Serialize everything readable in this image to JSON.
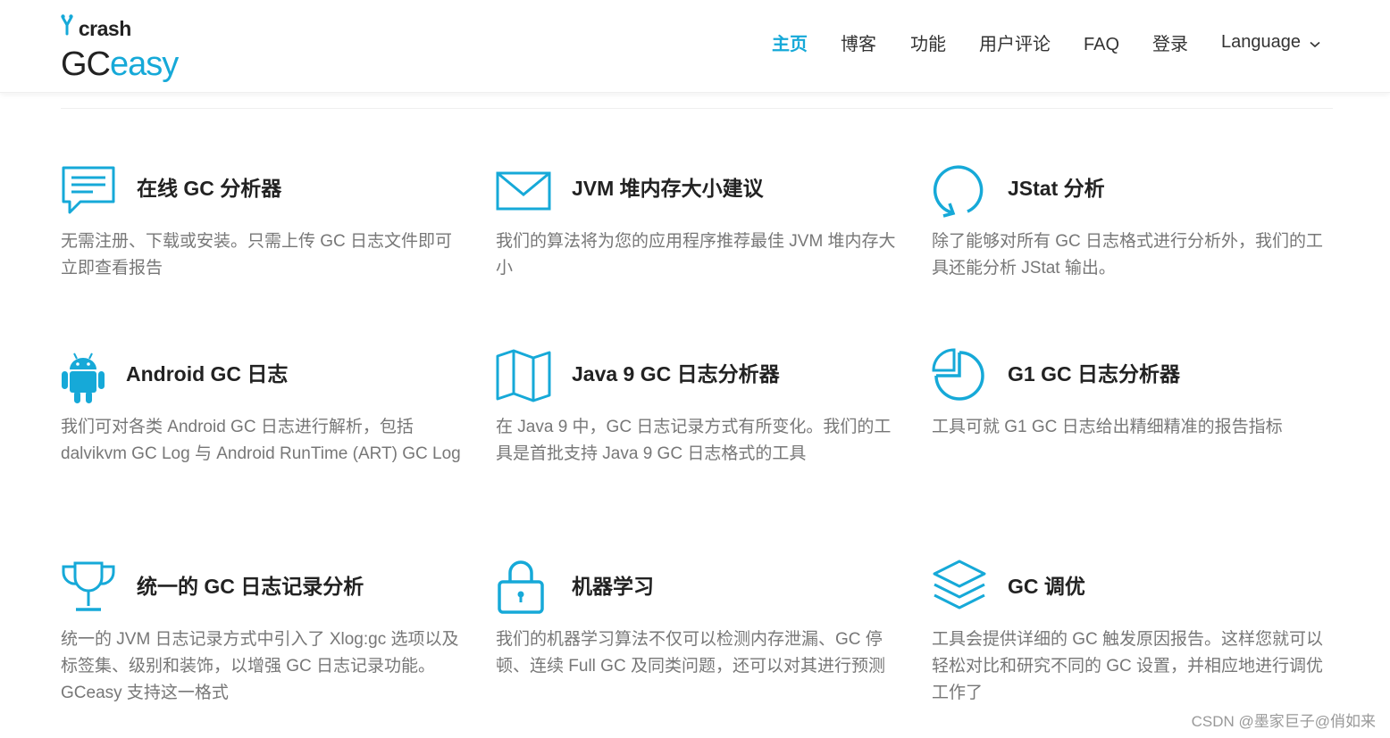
{
  "header": {
    "logo": {
      "brand_top": "crash",
      "brand_main": "GC",
      "brand_accent": "easy"
    },
    "nav": [
      {
        "label": "主页",
        "active": true
      },
      {
        "label": "博客"
      },
      {
        "label": "功能"
      },
      {
        "label": "用户评论"
      },
      {
        "label": "FAQ"
      },
      {
        "label": "登录"
      },
      {
        "label": "Language"
      }
    ]
  },
  "features": [
    {
      "icon": "chat-icon",
      "title": "在线 GC 分析器",
      "desc": "无需注册、下载或安装。只需上传 GC 日志文件即可立即查看报告"
    },
    {
      "icon": "envelope-icon",
      "title": "JVM 堆内存大小建议",
      "desc": "我们的算法将为您的应用程序推荐最佳 JVM 堆内存大小"
    },
    {
      "icon": "refresh-icon",
      "title": "JStat 分析",
      "desc": "除了能够对所有 GC 日志格式进行分析外，我们的工具还能分析 JStat 输出。"
    },
    {
      "icon": "android-icon",
      "title": "Android GC 日志",
      "desc": "我们可对各类 Android GC 日志进行解析，包括 dalvikvm GC Log 与 Android RunTime (ART) GC Log"
    },
    {
      "icon": "map-icon",
      "title": "Java 9 GC 日志分析器",
      "desc": "在 Java 9 中，GC 日志记录方式有所变化。我们的工具是首批支持 Java 9 GC 日志格式的工具"
    },
    {
      "icon": "pie-chart-icon",
      "title": "G1 GC 日志分析器",
      "desc": "工具可就 G1 GC 日志给出精细精准的报告指标"
    },
    {
      "icon": "trophy-icon",
      "title": "统一的 GC 日志记录分析",
      "desc": "统一的 JVM 日志记录方式中引入了 Xlog:gc 选项以及标签集、级别和装饰，以增强 GC 日志记录功能。GCeasy 支持这一格式"
    },
    {
      "icon": "lock-icon",
      "title": "机器学习",
      "desc": "我们的机器学习算法不仅可以检测内存泄漏、GC 停顿、连续 Full GC 及同类问题，还可以对其进行预测"
    },
    {
      "icon": "layers-icon",
      "title": "GC 调优",
      "desc": "工具会提供详细的 GC 触发原因报告。这样您就可以轻松对比和研究不同的 GC 设置，并相应地进行调优工作了"
    }
  ],
  "watermark": "CSDN @墨家巨子@俏如来",
  "colors": {
    "accent": "#16a9d8",
    "title": "#222222",
    "text": "#777777"
  }
}
